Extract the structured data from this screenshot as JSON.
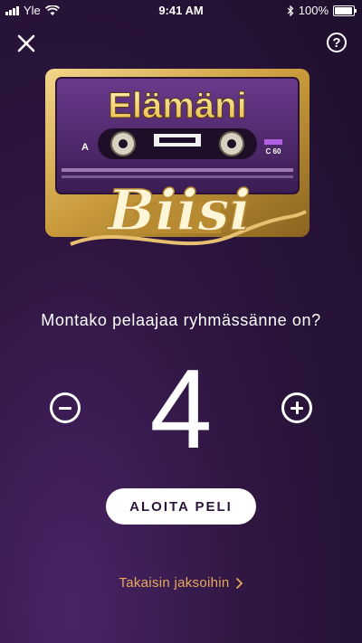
{
  "status_bar": {
    "carrier": "Yle",
    "time": "9:41 AM",
    "battery": "100%",
    "signal_bars": 4
  },
  "header": {
    "close_icon": "close-icon",
    "help_icon": "help-icon"
  },
  "logo": {
    "top_text": "Elämäni",
    "bottom_text": "Biisi",
    "tape_side": "A",
    "tape_length": "C 60"
  },
  "question": "Montako pelaajaa ryhmässänne on?",
  "player_count": "4",
  "start_button": "ALOITA PELI",
  "back_link": "Takaisin jaksoihin",
  "colors": {
    "background_dark": "#1f0f2c",
    "background_light": "#4a2466",
    "accent_gold": "#e8a95c",
    "button_text": "#2b1538"
  }
}
